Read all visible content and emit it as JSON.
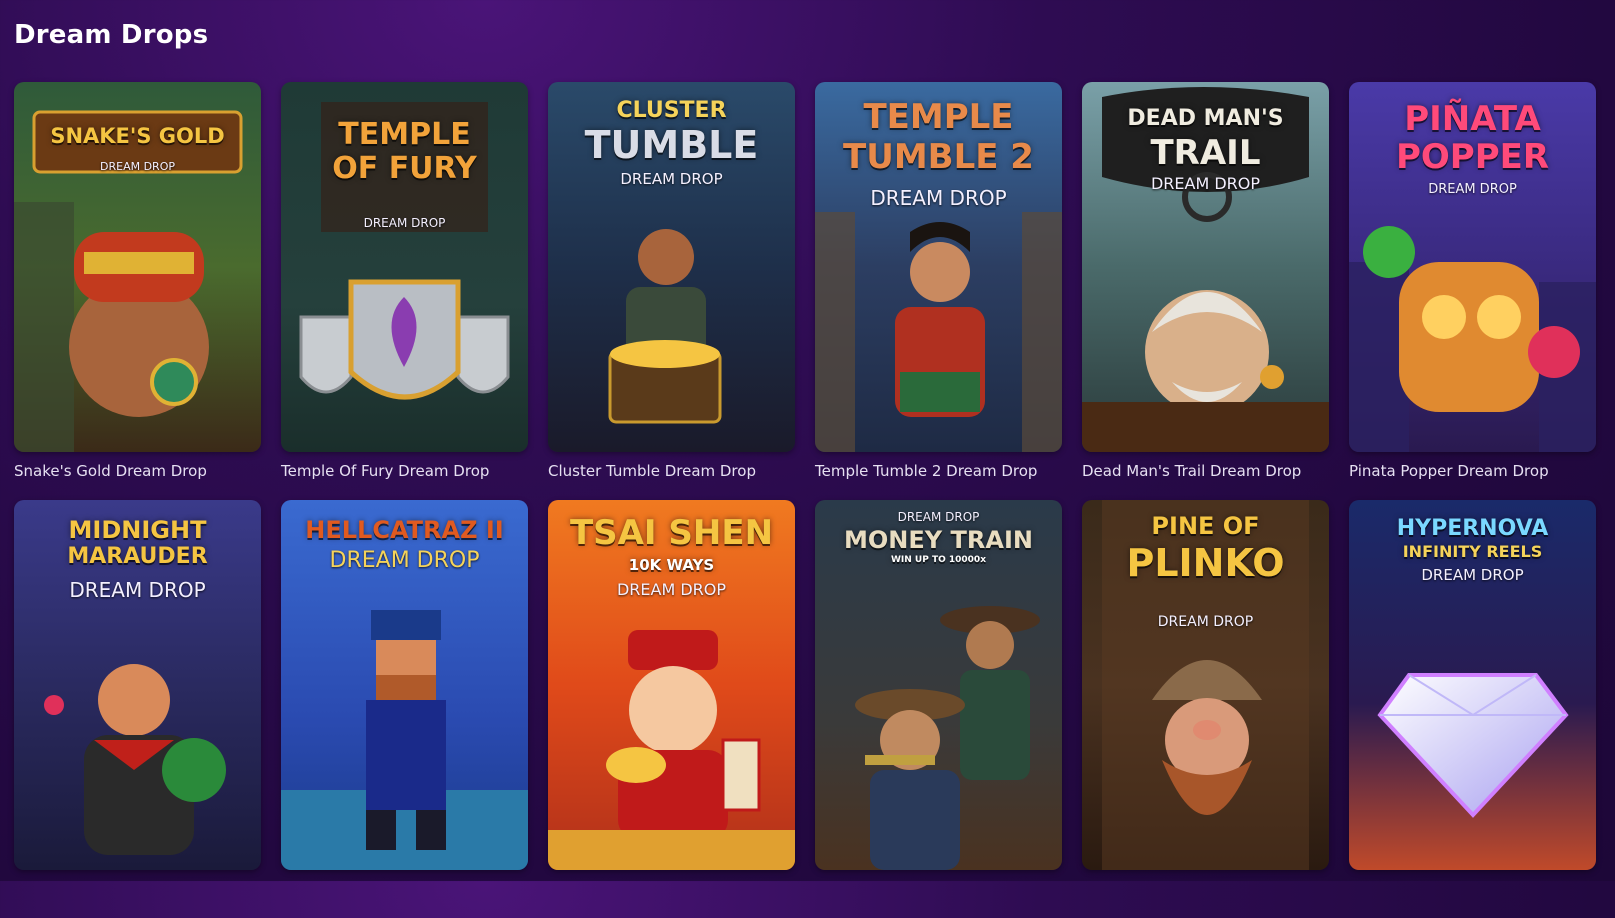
{
  "section": {
    "title": "Dream Drops"
  },
  "games": [
    {
      "title": "Snake's Gold Dream Drop",
      "logo_line1": "SNAKE'S GOLD",
      "logo_line2": "",
      "badge": "DREAM DROP"
    },
    {
      "title": "Temple Of Fury Dream Drop",
      "logo_line1": "TEMPLE",
      "logo_line2": "OF FURY",
      "badge": "DREAM DROP"
    },
    {
      "title": "Cluster Tumble Dream Drop",
      "logo_line1": "CLUSTER",
      "logo_line2": "TUMBLE",
      "badge": "DREAM DROP"
    },
    {
      "title": "Temple Tumble 2 Dream Drop",
      "logo_line1": "TEMPLE",
      "logo_line2": "TUMBLE 2",
      "badge": "DREAM DROP"
    },
    {
      "title": "Dead Man's Trail Dream Drop",
      "logo_line1": "DEAD MAN'S",
      "logo_line2": "TRAIL",
      "badge": "DREAM DROP"
    },
    {
      "title": "Pinata Popper Dream Drop",
      "logo_line1": "PIÑATA",
      "logo_line2": "POPPER",
      "badge": "DREAM DROP"
    },
    {
      "title": "",
      "logo_line1": "MIDNIGHT",
      "logo_line2": "MARAUDER",
      "badge": "DREAM DROP"
    },
    {
      "title": "",
      "logo_line1": "HELLCATRAZ II",
      "logo_line2": "",
      "badge": "DREAM DROP"
    },
    {
      "title": "",
      "logo_line1": "TSAI SHEN",
      "logo_line2": "10K WAYS",
      "badge": "DREAM DROP"
    },
    {
      "title": "",
      "logo_line1": "MONEY TRAIN",
      "logo_line2": "WIN UP TO 10000x",
      "badge": "DREAM DROP"
    },
    {
      "title": "",
      "logo_line1": "PINE OF",
      "logo_line2": "PLINKO",
      "badge": "DREAM DROP"
    },
    {
      "title": "",
      "logo_line1": "HYPERNOVA",
      "logo_line2": "INFINITY REELS",
      "badge": "DREAM DROP"
    }
  ],
  "colors": {
    "page_bg": "#2a0a4a",
    "title_text": "#ffffff",
    "game_title_text": "#e6e0f2"
  }
}
